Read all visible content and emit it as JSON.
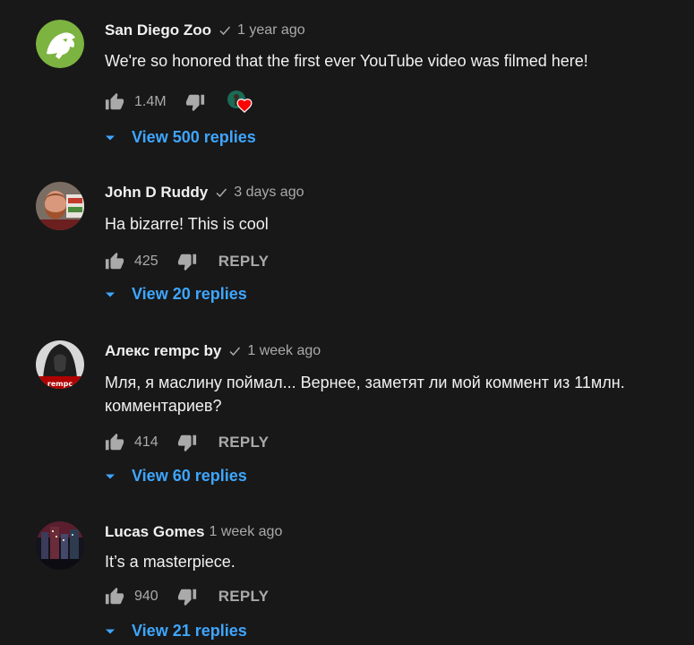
{
  "comments": [
    {
      "author": "San Diego Zoo",
      "verified": true,
      "time": "1 year ago",
      "text": "We're so honored that the first ever YouTube video was filmed here!",
      "likes": "1.4M",
      "hearted_by_creator": true,
      "reply_label": "",
      "view_replies": "View 500 replies",
      "avatar": "lion-logo"
    },
    {
      "author": "John D Ruddy",
      "verified": true,
      "time": "3 days ago",
      "text": "Ha bizarre! This is cool",
      "likes": "425",
      "hearted_by_creator": false,
      "reply_label": "REPLY",
      "view_replies": "View 20 replies",
      "avatar": "bearded-man-photo"
    },
    {
      "author": "Алекс rempc by",
      "verified": true,
      "time": "1 week ago",
      "text": "Мля, я маслину поймал... Вернее, заметят ли мой коммент из 11млн. комментариев?",
      "likes": "414",
      "hearted_by_creator": false,
      "reply_label": "REPLY",
      "view_replies": "View 60 replies",
      "avatar": "hooded-assassin-logo"
    },
    {
      "author": "Lucas Gomes",
      "verified": false,
      "time": "1 week ago",
      "text": "It’s a masterpiece.",
      "likes": "940",
      "hearted_by_creator": false,
      "reply_label": "REPLY",
      "view_replies": "View 21 replies",
      "avatar": "city-night-photo"
    }
  ],
  "colors": {
    "background": "#181818",
    "text": "#f1f1f1",
    "secondary": "#aaaaaa",
    "link": "#3ea6ff",
    "heart": "#ff0000"
  },
  "icons": {
    "like": "thumb-up-icon",
    "dislike": "thumb-down-icon",
    "verified": "check-icon",
    "expand": "caret-down-icon"
  }
}
